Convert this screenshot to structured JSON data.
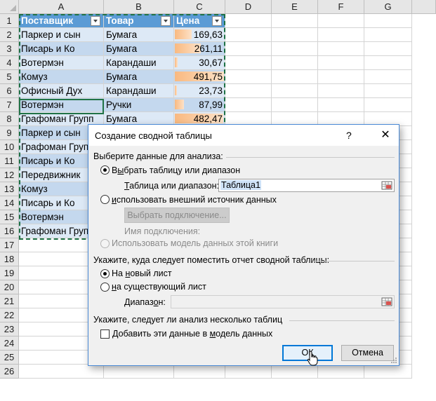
{
  "sheet": {
    "columns": [
      "A",
      "B",
      "C",
      "D",
      "E",
      "F",
      "G"
    ],
    "rows": [
      "1",
      "2",
      "3",
      "4",
      "5",
      "6",
      "7",
      "8",
      "9",
      "10",
      "11",
      "12",
      "13",
      "14",
      "15",
      "16",
      "17",
      "18",
      "19",
      "20",
      "21",
      "22",
      "23",
      "24",
      "25",
      "26"
    ],
    "table_headers": [
      "Поставщик",
      "Товар",
      "Цена"
    ],
    "data": [
      {
        "supplier": "Паркер и сын",
        "product": "Бумага",
        "price": "169,63",
        "value": 169.63
      },
      {
        "supplier": "Писарь и Ко",
        "product": "Бумага",
        "price": "261,11",
        "value": 261.11
      },
      {
        "supplier": "Вотермэн",
        "product": "Карандаши",
        "price": "30,67",
        "value": 30.67
      },
      {
        "supplier": "Комуз",
        "product": "Бумага",
        "price": "491,75",
        "value": 491.75
      },
      {
        "supplier": "Офисный Дух",
        "product": "Карандаши",
        "price": "23,73",
        "value": 23.73
      },
      {
        "supplier": "Вотермэн",
        "product": "Ручки",
        "price": "87,99",
        "value": 87.99
      },
      {
        "supplier": "Графоман Групп",
        "product": "Бумага",
        "price": "482,47",
        "value": 482.47
      },
      {
        "supplier": "Паркер и сын",
        "product": "",
        "price": "",
        "value": 0
      },
      {
        "supplier": "Графоман Групп",
        "product": "",
        "price": "",
        "value": 0
      },
      {
        "supplier": "Писарь и Ко",
        "product": "",
        "price": "",
        "value": 0
      },
      {
        "supplier": "Передвижник",
        "product": "",
        "price": "",
        "value": 0
      },
      {
        "supplier": "Комуз",
        "product": "",
        "price": "",
        "value": 0
      },
      {
        "supplier": "Писарь и Ко",
        "product": "",
        "price": "",
        "value": 0
      },
      {
        "supplier": "Вотермэн",
        "product": "",
        "price": "",
        "value": 0
      },
      {
        "supplier": "Графоман Групп",
        "product": "",
        "price": "",
        "value": 0
      }
    ],
    "max_value": 491.75,
    "colors": {
      "header_fill": "#5b9bd5",
      "band_light": "#dde9f6",
      "band_dark": "#c4d8ee",
      "data_bar": "#f9b980",
      "active_border": "#217346"
    }
  },
  "dialog": {
    "title": "Создание сводной таблицы",
    "help": "?",
    "close": "✕",
    "section1": "Выберите данные для анализа:",
    "opt_table_pre": "В",
    "opt_table_u": "ы",
    "opt_table_post": "брать таблицу или диапазон",
    "range_label_pre": "",
    "range_label_u": "Т",
    "range_label_post": "аблица или диапазон:",
    "range_value": "Таблица1",
    "opt_external_u": "и",
    "opt_external_post": "спользовать внешний источник данных",
    "choose_connection": "Выбрать подключение...",
    "connection_name": "Имя подключения:",
    "opt_datamodel": "Использовать модель данных этой книги",
    "section2": "Укажите, куда следует поместить отчет сводной таблицы:",
    "opt_newsheet_pre": "На ",
    "opt_newsheet_u": "н",
    "opt_newsheet_post": "овый лист",
    "opt_existing_u": "н",
    "opt_existing_post": "а существующий лист",
    "location_label_pre": "Диапаз",
    "location_label_u": "о",
    "location_label_post": "н:",
    "location_value": "",
    "section3": "Укажите, следует ли анализ несколько таблиц",
    "add_model_pre": "Добавить эти данные в ",
    "add_model_u": "м",
    "add_model_post": "одель данных",
    "ok": "ОК",
    "cancel": "Отмена"
  }
}
